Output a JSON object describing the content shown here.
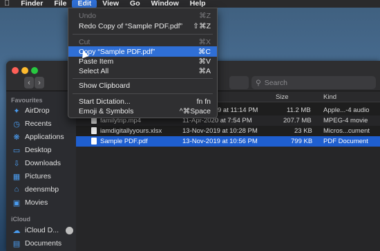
{
  "menubar": {
    "apple": "",
    "items": [
      "Finder",
      "File",
      "Edit",
      "View",
      "Go",
      "Window",
      "Help"
    ]
  },
  "edit_menu": {
    "items": [
      {
        "label": "Undo",
        "shortcut": "⌘Z"
      },
      {
        "label": "Redo Copy of “Sample PDF.pdf”",
        "shortcut": "⇧⌘Z"
      },
      {
        "label": "Cut",
        "shortcut": "⌘X"
      },
      {
        "label": "Copy “Sample PDF.pdf”",
        "shortcut": "⌘C"
      },
      {
        "label": "Paste Item",
        "shortcut": "⌘V"
      },
      {
        "label": "Select All",
        "shortcut": "⌘A"
      },
      {
        "label": "Show Clipboard",
        "shortcut": ""
      },
      {
        "label": "Start Dictation...",
        "shortcut": "fn fn"
      },
      {
        "label": "Emoji & Symbols",
        "shortcut": "^⌘Space"
      }
    ]
  },
  "finder": {
    "search_placeholder": "Search",
    "sidebar": {
      "favourites_title": "Favourites",
      "favourites": [
        "AirDrop",
        "Recents",
        "Applications",
        "Desktop",
        "Downloads",
        "Pictures",
        "deensmbp",
        "Movies"
      ],
      "icloud_title": "iCloud",
      "icloud": [
        "iCloud D...",
        "Documents"
      ]
    },
    "columns": {
      "size": "Size",
      "kind": "Kind"
    },
    "rows": [
      {
        "name": "",
        "date": "9 at 11:14 PM",
        "size": "11.2 MB",
        "kind": "Apple...-4 audio"
      },
      {
        "name": "familytrip.mp4",
        "date": "11-Apr-2020 at 7:54 PM",
        "size": "207.7 MB",
        "kind": "MPEG-4 movie"
      },
      {
        "name": "iamdigitallyyours.xlsx",
        "date": "13-Nov-2019 at 10:28 PM",
        "size": "23 KB",
        "kind": "Micros...cument"
      },
      {
        "name": "Sample PDF.pdf",
        "date": "13-Nov-2019 at 10:56 PM",
        "size": "799 KB",
        "kind": "PDF Document"
      }
    ]
  },
  "colors": {
    "accent": "#2f6fd6",
    "selection": "#1f5fd0"
  }
}
